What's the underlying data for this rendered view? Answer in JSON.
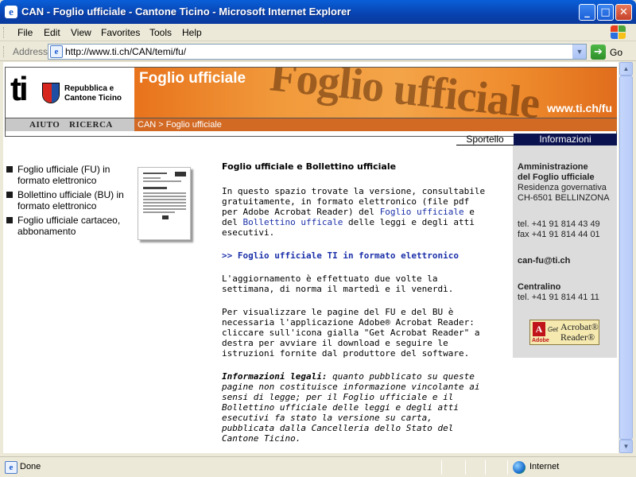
{
  "window": {
    "title": "CAN - Foglio ufficiale - Cantone Ticino - Microsoft Internet Explorer",
    "app_icon": "ie-icon",
    "minimize": "_",
    "maximize": "□",
    "close": "✕"
  },
  "menu": {
    "items": [
      "File",
      "Edit",
      "View",
      "Favorites",
      "Tools",
      "Help"
    ]
  },
  "address": {
    "label": "Address",
    "url": "http://www.ti.ch/CAN/temi/fu/",
    "go": "Go"
  },
  "header": {
    "logo_ti": "ti",
    "logo_line1": "Repubblica e",
    "logo_line2": "Cantone Ticino",
    "banner_title": "Foglio ufficiale",
    "banner_big": "Foglio ufficiale",
    "banner_url": "www.ti.ch/fu",
    "nav": [
      "AIUTO",
      "RICERCA"
    ],
    "breadcrumb": "CAN > Foglio ufficiale"
  },
  "tabs": {
    "sportello": "Sportello",
    "informazioni": "Informazioni"
  },
  "leftnav": [
    "Foglio ufficiale (FU) in formato elettronico",
    "Bollettino ufficiale (BU) in formato elettronico",
    "Foglio ufficiale cartaceo, abbonamento"
  ],
  "main": {
    "heading": "Foglio ufficiale e Bollettino ufficiale",
    "p1_pre": "In questo spazio trovate la versione, consultabile gratuitamente, in formato elettronico (file pdf per Adobe Acrobat Reader) del ",
    "p1_link1": "Foglio ufficiale",
    "p1_mid": " e del ",
    "p1_link2": "Bollettino ufficale",
    "p1_post": " delle leggi e degli atti esecutivi.",
    "pdf_link": ">> Foglio ufficiale TI in formato elettronico",
    "p2": "L'aggiornamento è effettuato due volte la settimana, di norma il martedì e il venerdì.",
    "p3": "Per visualizzare le pagine del FU e del BU è necessaria l'applicazione Adobe® Acrobat Reader: cliccare sull'icona gialla \"Get Acrobat Reader\" a destra per avviare il download e seguire le istruzioni fornite dal produttore del software.",
    "legal_label": "Informazioni legali:",
    "legal_text": " quanto pubblicato su queste pagine non costituisce informazione vincolante ai sensi di legge; per il Foglio ufficiale e il Bollettino ufficiale delle leggi e degli atti esecutivi fa stato la versione su carta, pubblicata dalla Cancelleria dello Stato del Cantone Ticino."
  },
  "info": {
    "org_line1": "Amministrazione",
    "org_line2": "del Foglio ufficiale",
    "addr1": "Residenza governativa",
    "addr2": "CH-6501 BELLINZONA",
    "tel": "tel. +41 91 814 43 49",
    "fax": "fax +41 91 814 44 01",
    "email": "can-fu@ti.ch",
    "centralino_label": "Centralino",
    "centralino_tel": "tel. +41 91 814 41 11",
    "acrobat_get": "Get",
    "acrobat_name1": "Acrobat®",
    "acrobat_name2": "Reader®",
    "acrobat_adobe": "Adobe"
  },
  "status": {
    "text": "Done",
    "zone": "Internet"
  }
}
